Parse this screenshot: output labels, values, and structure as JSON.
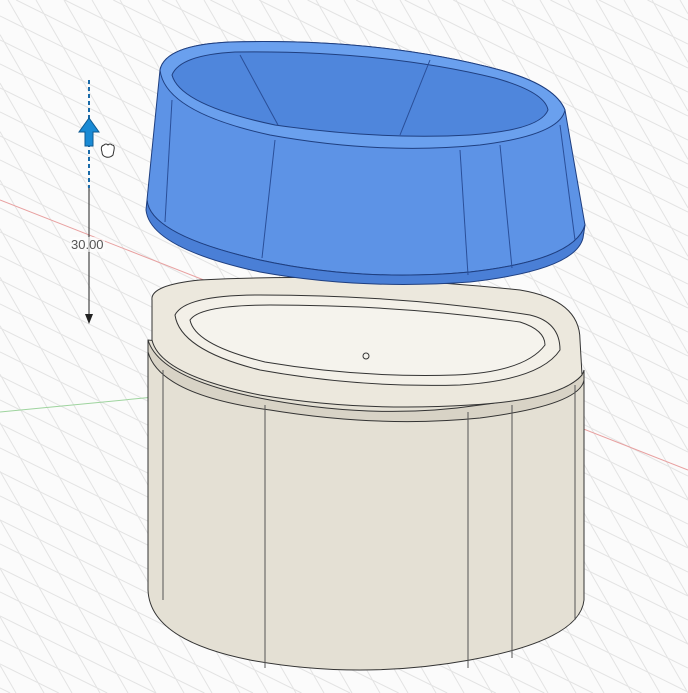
{
  "viewport": {
    "dimension_value": "30.00",
    "colors": {
      "lid": "#5b8fe0",
      "lid_dark": "#3f6fc4",
      "base": "#e6e2d6",
      "base_dark": "#d3cec0",
      "grid": "#e2e2e2",
      "x_axis": "#e08a8a",
      "y_axis": "#8fd08f",
      "manipulator": "#1a8ad4"
    },
    "icons": [
      "move-arrow-icon",
      "hand-cursor-icon"
    ]
  }
}
